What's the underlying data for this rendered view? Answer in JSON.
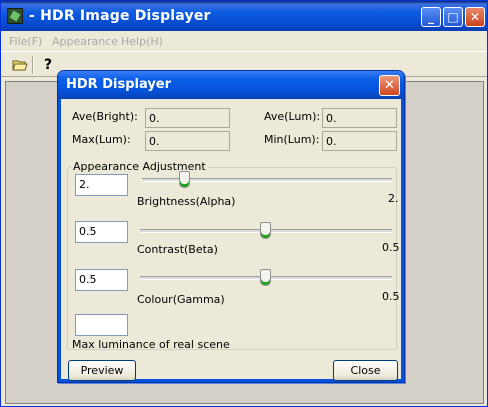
{
  "main_window": {
    "title": "- HDR Image Displayer",
    "buttons": {
      "minimize": "_",
      "maximize": "□",
      "close": "✕"
    },
    "menu": [
      "File(F)",
      "Appearance",
      "Help(H)"
    ]
  },
  "toolbar": {
    "open_icon": "open-folder-icon",
    "help_icon": "?"
  },
  "dialog": {
    "title": "HDR Displayer",
    "close_glyph": "✕",
    "stats": {
      "ave_bright_label": "Ave(Bright):",
      "ave_bright_value": "0.",
      "ave_lum_label": "Ave(Lum):",
      "ave_lum_value": "0.",
      "max_lum_label": "Max(Lum):",
      "max_lum_value": "0.",
      "min_lum_label": "Min(Lum):",
      "min_lum_value": "0."
    },
    "adjustment": {
      "group_title": "Appearance Adjustment",
      "brightness": {
        "input_value": "2.",
        "label": "Brightness(Alpha)",
        "readout": "2.",
        "level": 0.17
      },
      "contrast": {
        "input_value": "0.5",
        "label": "Contrast(Beta)",
        "readout": "0.5",
        "level": 0.5
      },
      "colour": {
        "input_value": "0.5",
        "label": "Colour(Gamma)",
        "readout": "0.5",
        "level": 0.5
      },
      "max_luminance": {
        "input_value": "",
        "label": "Max luminance of real scene"
      }
    },
    "preview_label": "Preview",
    "close_label": "Close"
  },
  "colors": {
    "xp_blue": "#0553dc",
    "close_red": "#d4461e",
    "dialog_face": "#ece9d8",
    "thumb_green": "#21a121"
  }
}
